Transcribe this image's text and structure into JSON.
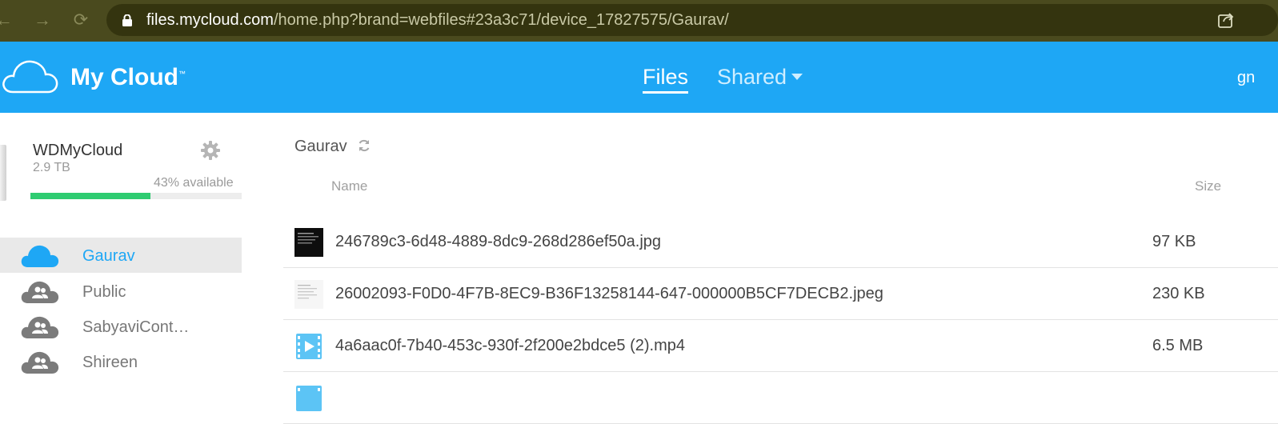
{
  "browser": {
    "url_host": "files.mycloud.com",
    "url_path": "/home.php?brand=webfiles#23a3c71/device_17827575/Gaurav/"
  },
  "header": {
    "brand": "My Cloud",
    "brand_tm": "™",
    "tab_files": "Files",
    "tab_shared": "Shared",
    "user_initials": "gn",
    "accent_color": "#1ea7f5"
  },
  "device": {
    "name": "WDMyCloud",
    "capacity": "2.9 TB",
    "available_text": "43% available",
    "used_fraction": 0.57
  },
  "shares": [
    {
      "label": "Gaurav",
      "icon": "cloud-icon",
      "active": true
    },
    {
      "label": "Public",
      "icon": "shared-cloud-icon",
      "active": false
    },
    {
      "label": "SabyaviCont…",
      "icon": "shared-cloud-icon",
      "active": false
    },
    {
      "label": "Shireen",
      "icon": "shared-cloud-icon",
      "active": false
    }
  ],
  "main": {
    "breadcrumb": "Gaurav",
    "col_name": "Name",
    "col_size": "Size",
    "files": [
      {
        "name": "246789c3-6d48-4889-8dc9-268d286ef50a.jpg",
        "size": "97 KB",
        "thumb": "dark-image-thumbnail"
      },
      {
        "name": "26002093-F0D0-4F7B-8EC9-B36F13258144-647-000000B5CF7DECB2.jpeg",
        "size": "230 KB",
        "thumb": "document-image-thumbnail"
      },
      {
        "name": "4a6aac0f-7b40-453c-930f-2f200e2bdce5 (2).mp4",
        "size": "6.5 MB",
        "thumb": "video-icon"
      },
      {
        "name": "",
        "size": "",
        "thumb": "video-icon"
      }
    ]
  }
}
